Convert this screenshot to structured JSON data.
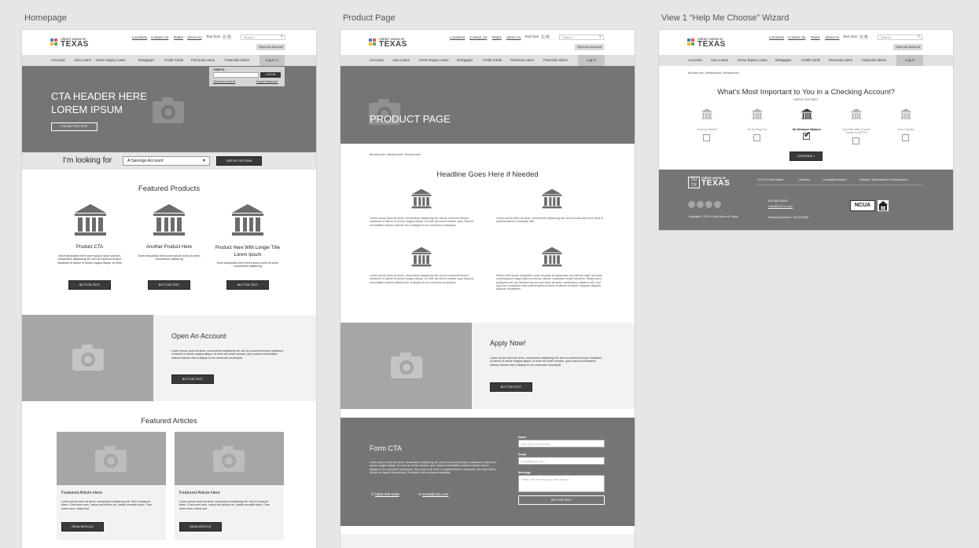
{
  "boards": {
    "homepage_label": "Homepage",
    "product_label": "Product Page",
    "wizard_label": "View 1 “Help Me Choose” Wizard"
  },
  "header": {
    "brand_small": "CREDIT UNION OF",
    "brand_big": "TEXAS",
    "utility_links": [
      "Locations",
      "Contact Us",
      "Rates",
      "About Us"
    ],
    "text_size_label": "Text Size",
    "text_size_minus": "-",
    "text_size_plus": "+",
    "search_placeholder": "Search",
    "open_account": "Open An Account"
  },
  "nav": {
    "items": [
      "Accounts",
      "Auto Loans",
      "Home Equity Loans",
      "Mortgages",
      "Credit Cards",
      "Personal Loans",
      "Financial Advice"
    ],
    "login": "Log In",
    "login_home": "Log In ∧"
  },
  "login_dropdown": {
    "user_label": "USER ID",
    "login_button": "LOG IN",
    "enroll_link": "Click here to enroll",
    "forgot_link": "Forgot Password?"
  },
  "homepage": {
    "hero_line1": "CTA HEADER HERE",
    "hero_line2": "LOREM IPSUM",
    "hero_button": "CTA BUTTON TEXT",
    "looking_for_label": "I’m looking for",
    "looking_for_value": "A Savings Account",
    "see_options": "SEE MY OPTIONS",
    "featured_products_title": "Featured Products",
    "products": [
      {
        "title": "Product CTA",
        "desc": "Short description here lorem ipsum dolor sit amet, consectetur adipiscing elit, sed do eiusmod tempor incididunt ut labore et dolore magna aliqua. Ut enim",
        "button": "BUTTON TEXT"
      },
      {
        "title": "Another Product Here",
        "desc": "Short description here lorem ipsum dolor sit amet, consectetur adipiscing",
        "button": "BUTTON TEXT"
      },
      {
        "title": "Product Here With Longer Title Lorem Ipsum",
        "desc": "Short description here lorem ipsum dolor sit amet, consectetur adipiscing",
        "button": "BUTTON TEXT"
      }
    ],
    "open_title": "Open An Account",
    "open_body": "Lorem ipsum dolor sit amet, consectetur adipiscing elit, sed do eiusmod tempor incididunt ut labore et dolore magna aliqua. Ut enim ad minim veniam, quis nostrud exercitation ullamco laboris nisi ut aliquip ex ea commodo consequat.",
    "open_button": "BUTTON TEXT",
    "articles_title": "Featured Articles",
    "articles": [
      {
        "title": "Featured Article Here",
        "body": "Lorem ipsum dolor sit amet, consectetur adipiscing elit. Sed in euismod diam. Cras lorem sem, varius sed finibus ac, mattis convallis tortor. Cras lorem sem, varius sed",
        "button": "READ ARTICLE"
      },
      {
        "title": "Featured Article Here",
        "body": "Lorem ipsum dolor sit amet, consectetur adipiscing elit. Sed in euismod diam. Cras lorem sem, varius sed finibus ac, mattis convallis tortor. Cras lorem sem, varius sed",
        "button": "READ ARTICLE"
      }
    ]
  },
  "product": {
    "hero_title": "PRODUCT PAGE",
    "breadcrumbs": "Breadcrumb / Breadcrumb / Breadcrumb",
    "headline": "Headline Goes Here if Needed",
    "features": [
      "Lorem ipsum dolor sit amet, consectetur adipiscing elit, sed do eiusmod tempor incididunt ut labore et dolore magna aliqua. Ut enim ad minim veniam, quis nostrud exercitation ullamco laboris nisi ut aliquip ex ea commodo consequat.",
      "Lorem ipsum dolor sit amet, consectetur adipiscing elit, sed do Duis aute irure dolor in reprehenderit in voluptate velit",
      "Lorem ipsum dolor sit amet, consectetur adipiscing elit, sed do eiusmod tempor incididunt ut labore et dolore magna aliqua. Ut enim ad minim veniam, quis nostrud exercitation ullamco laboris nisi ut aliquip ex ea commodo consequat.",
      "Nemo enim ipsam voluptatem quia voluptas sit aspernatur aut odit aut fugit, sed quia consequuntur magni dolores eos qui ratione voluptatem sequi nesciunt. Neque porro quisquam est, qui dolorem ipsum quia dolor sit amet, consectetur, adipisci velit, sed quia non numquam eius modi tempora incidunt ut labore et dolore magnam aliquam quaerat voluptatem."
    ],
    "apply_title": "Apply Now!",
    "apply_body": "Lorem ipsum dolor sit amet, consectetur adipiscing elit, sed do eiusmod tempor incididunt ut labore et dolore magna aliqua. Ut enim ad minim veniam, quis nostrud exercitation ullamco laboris nisi ut aliquip ex ea commodo consequat.",
    "apply_button": "BUTTON TEXT",
    "form_title": "Form CTA",
    "form_body": "Lorem ipsum dolor sit amet, consectetur adipiscing elit, sed do eiusmod tempor incididunt ut labore et dolore magna aliqua. Ut enim ad minim veniam, quis nostrud exercitation ullamco laboris nisi ut aliquip ex ea commodo consequat. Duis aute irure dolor in reprehenderit in voluptate velit esse cillum dolore eu fugiat nulla pariatur. Excepteur sint occaecat cupidatat.",
    "phone": "(555) 555 5555",
    "email": "email@cutx.com",
    "name_label": "Name",
    "name_placeholder": "First and Last Name",
    "email_label": "Email",
    "email_placeholder": "email@cutx.com",
    "message_label": "Message",
    "message_placeholder": "What can we help you with today?",
    "submit": "BUTTON TEXT"
  },
  "wizard": {
    "breadcrumbs": "Breadcrumb / Breadcrumb / Breadcrumb",
    "question": "What’s Most Important to You in a Checking Account?",
    "hint": "Select one item.",
    "options": [
      {
        "label": "Earning Interest",
        "checked": false
      },
      {
        "label": "No Monthly Fee",
        "checked": false
      },
      {
        "label": "No Minimum Balance",
        "checked": true
      },
      {
        "label": "Extra Benefits (Theme Tickets for $5 PP)",
        "checked": false
      },
      {
        "label": "Free Checks",
        "checked": false
      }
    ],
    "continue": "CONTINUE >",
    "footer_links": [
      "CUTX In the News",
      "Careers",
      "Complaint Notice",
      "Notices, Statements & Disclosures"
    ],
    "phone": "800-880-8800",
    "email": "help@CUTX.com",
    "routing": "Routing Number: 311274982",
    "copyright": "Copyright © 2019 Credit Union of Texas",
    "ncua": "NCUA"
  },
  "colors": {
    "hero_gray": "#757575",
    "placeholder_gray": "#a6a6a6",
    "button_dark": "#3a3a3a"
  }
}
